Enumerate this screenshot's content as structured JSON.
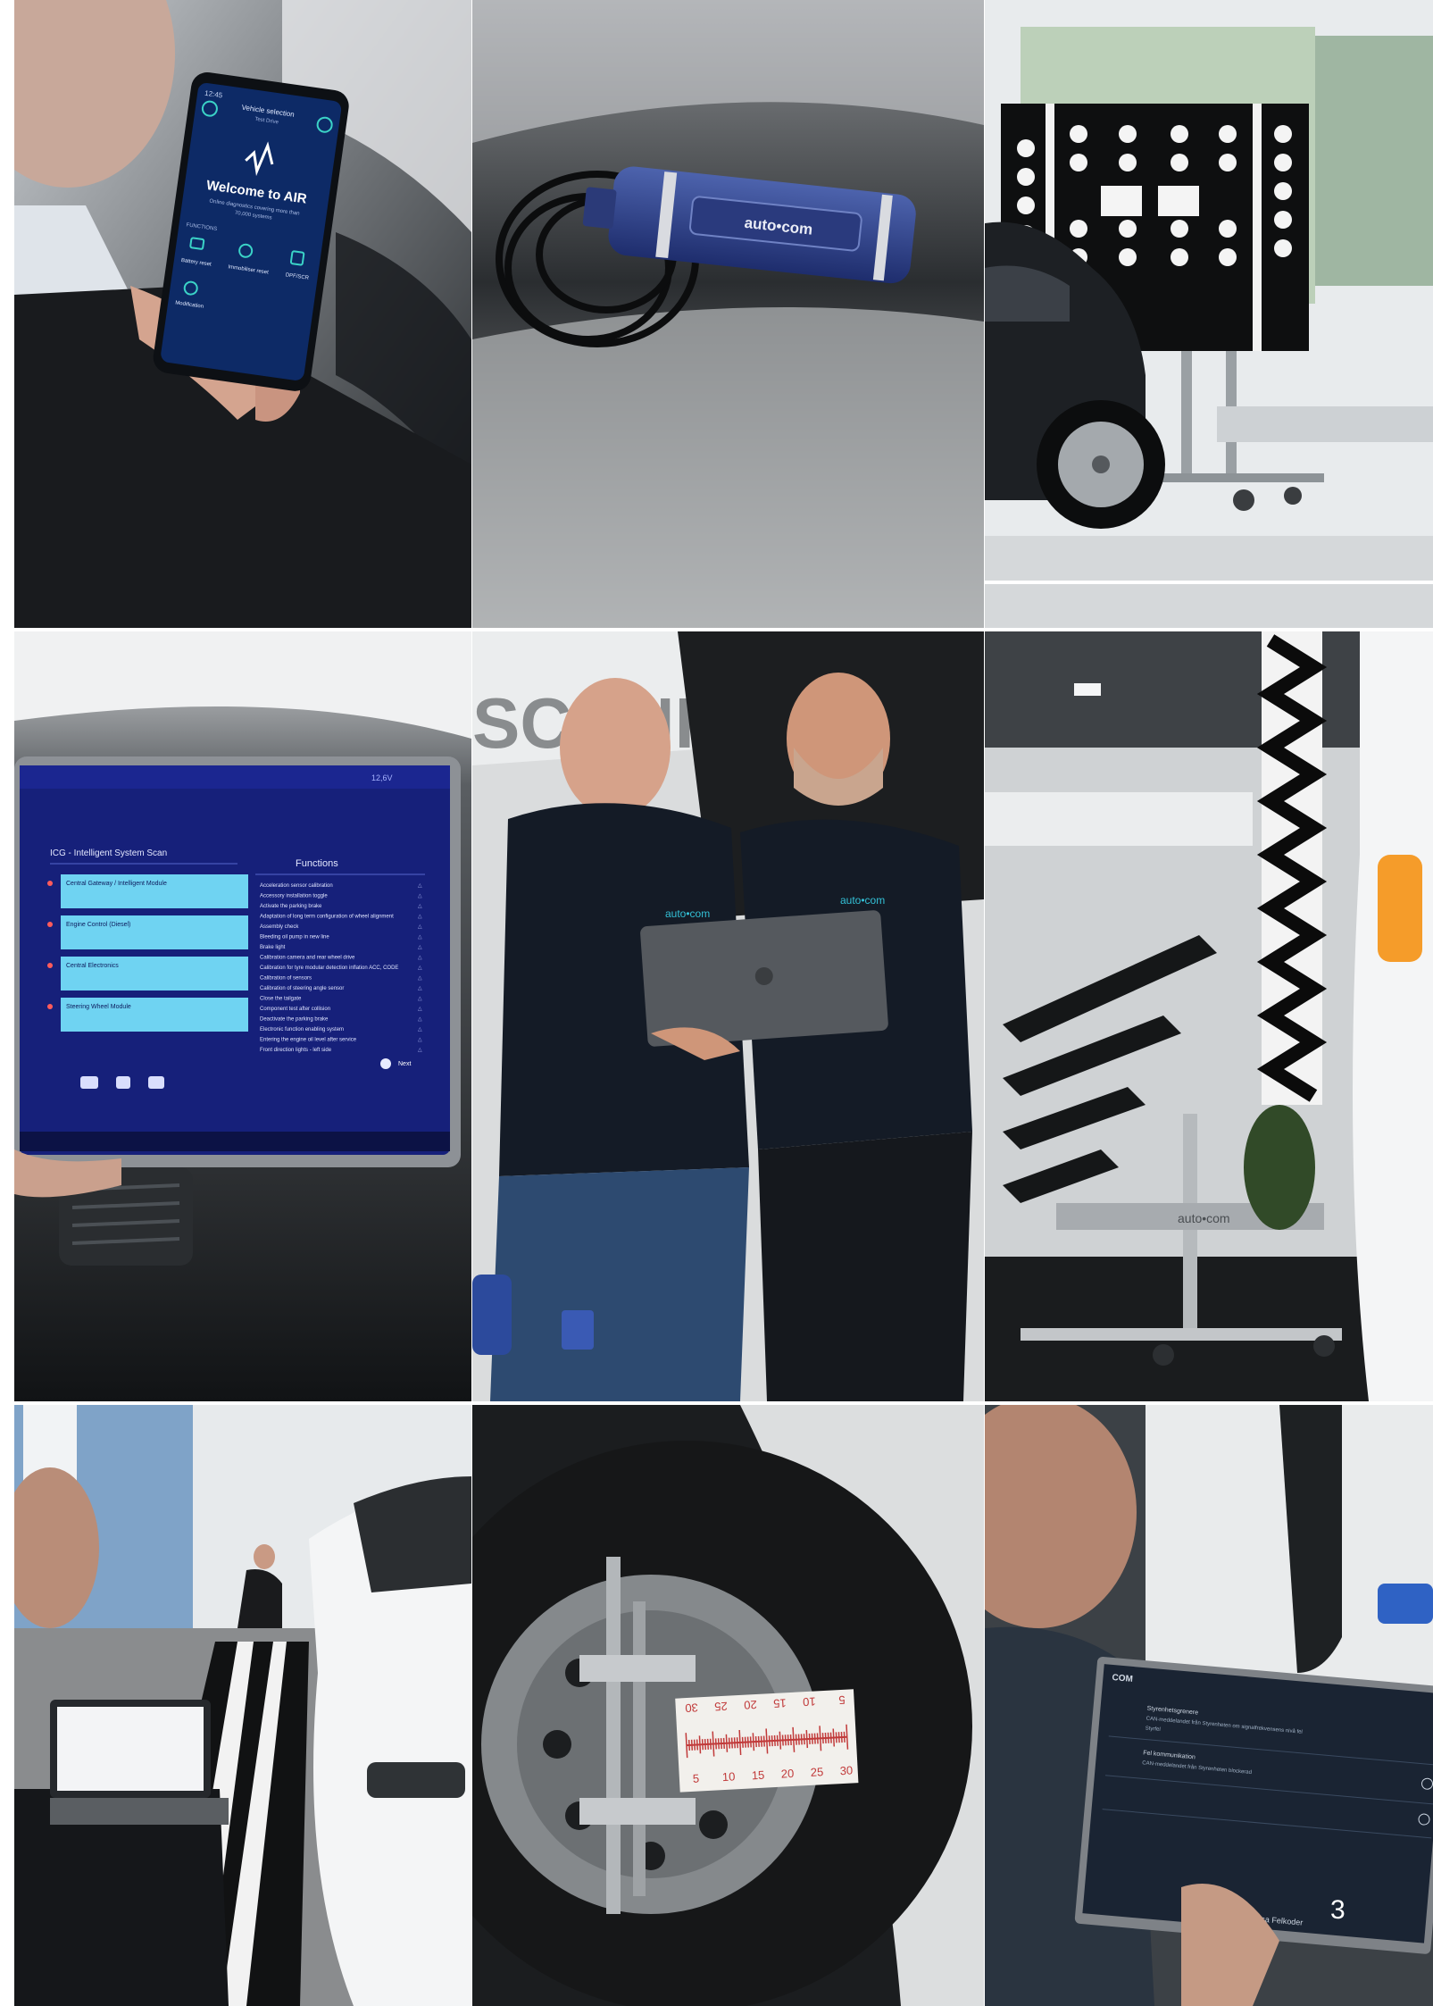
{
  "page": {
    "number": "3"
  },
  "tile_phone": {
    "status_left": "12:45",
    "header": "Vehicle selection",
    "header_sub": "Test Drive",
    "welcome": "Welcome to AIR",
    "tagline_1": "Online diagnostics covering more than",
    "tagline_2": "70,000 systems",
    "section": "FUNCTIONS",
    "fn_1": "Battery reset",
    "fn_2": "Immobiliser reset",
    "fn_3": "DPF/SCR",
    "fn_4": "Modification"
  },
  "tile_dongle": {
    "brand": "auto•com"
  },
  "tile_tablet": {
    "status": "12,6V",
    "left_title": "ICG - Intelligent System Scan",
    "right_title": "Functions",
    "left_items": [
      "Central Gateway / Intelligent Module",
      "Engine Control (Diesel)",
      "Central Electronics",
      "Steering Wheel Module"
    ],
    "functions": [
      "Acceleration sensor calibration",
      "Accessory installation toggle",
      "Activate the parking brake",
      "Adaptation of long term configuration of wheel alignment",
      "Assembly check",
      "Bleeding oil pump in new line",
      "Brake light",
      "Calibration camera and rear wheel drive",
      "Calibration for tyre modular detection inflation ACC, CODE",
      "Calibration of sensors",
      "Calibration of steering angle sensor",
      "Close the tailgate",
      "Component test after collision",
      "Deactivate the parking brake",
      "Electronic function enabling system",
      "Entering the engine oil level after service",
      "Front direction lights - left side"
    ],
    "next": "Next"
  },
  "tile_team": {
    "polo_logo": "auto•com",
    "truck_badge": "SCANIA"
  },
  "tile_adas_rig": {
    "rig_logo": "auto•com"
  },
  "tile_alignment": {
    "ruler_top": [
      "30",
      "25",
      "20",
      "15",
      "10",
      "5"
    ],
    "ruler_bottom": [
      "5",
      "10",
      "15",
      "20",
      "25",
      "30"
    ]
  },
  "tile_laptop": {
    "brand": "COM",
    "row_1": "Styrenhetsgrenere",
    "row_2": "CAN-meddelandet från Styrenheten om signalfrekvensens nivå fel",
    "row_3": "Styrfel",
    "row_4": "Fel kommunikation",
    "row_5": "CAN-meddelandet från Styrenheten blockerad",
    "footer": "Visa Felkoder"
  }
}
